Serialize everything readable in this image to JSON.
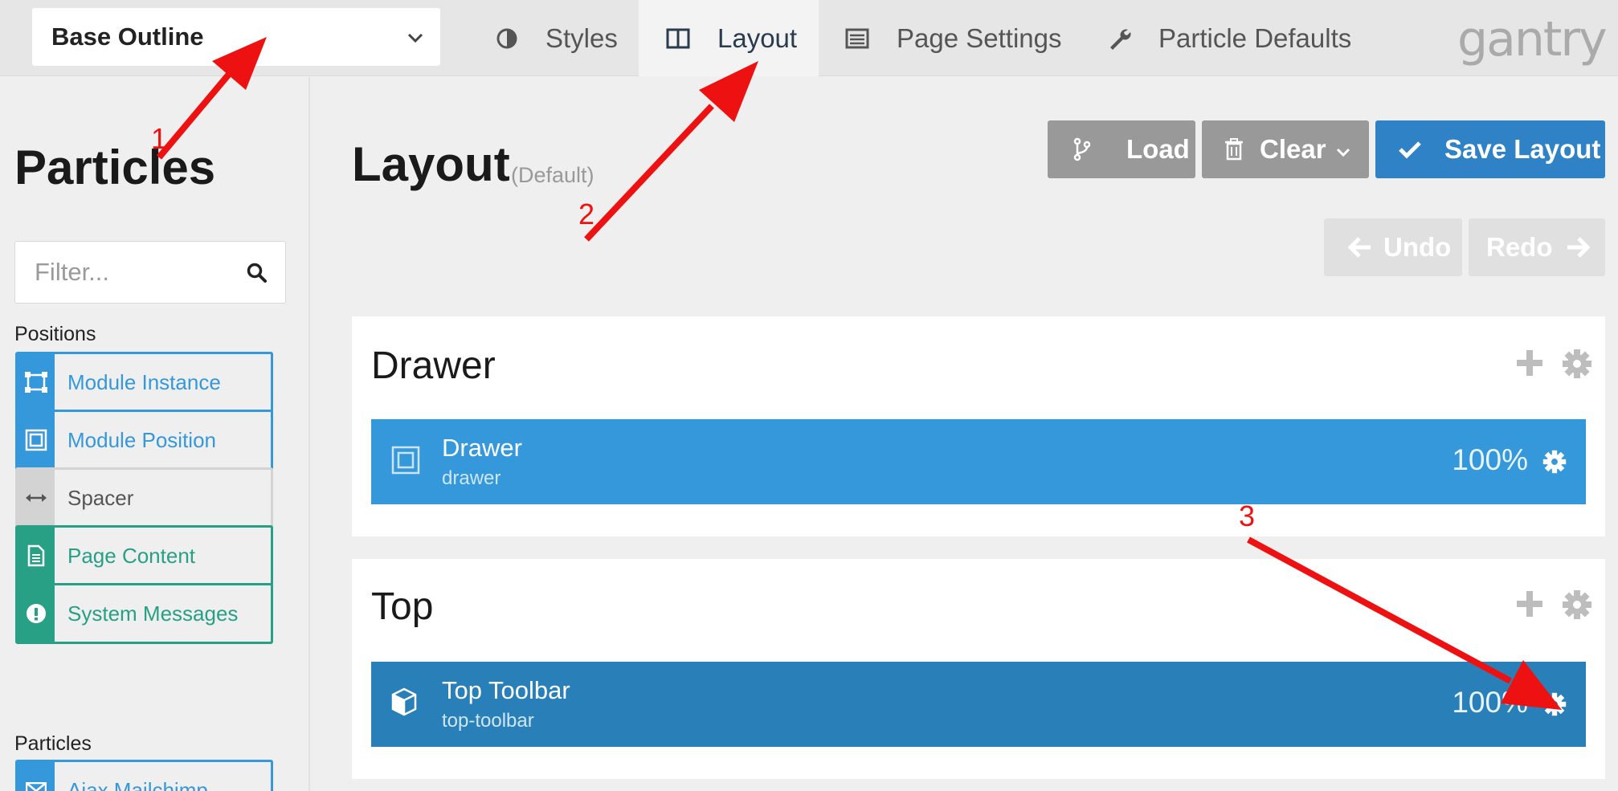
{
  "outline_selector": {
    "value": "Base Outline"
  },
  "tabs": [
    {
      "label": "Styles",
      "icon": "contrast-icon"
    },
    {
      "label": "Layout",
      "icon": "columns-icon",
      "active": true
    },
    {
      "label": "Page Settings",
      "icon": "list-alt-icon"
    },
    {
      "label": "Particle Defaults",
      "icon": "wrench-icon"
    }
  ],
  "brand": {
    "logo_text": "gantry"
  },
  "sidebar": {
    "title": "Particles",
    "filter_placeholder": "Filter...",
    "positions_label": "Positions",
    "positions": [
      {
        "label": "Module Instance",
        "icon": "module-instance-icon",
        "color": "blue"
      },
      {
        "label": "Module Position",
        "icon": "module-position-icon",
        "color": "blue"
      },
      {
        "label": "Spacer",
        "icon": "arrows-h-icon",
        "color": "grey"
      },
      {
        "label": "Page Content",
        "icon": "file-text-icon",
        "color": "green"
      },
      {
        "label": "System Messages",
        "icon": "exclamation-circle-icon",
        "color": "green"
      }
    ],
    "particles_label": "Particles",
    "particles": [
      {
        "label": "Ajax Mailchimp",
        "icon": "envelope-icon",
        "color": "blue"
      }
    ]
  },
  "main": {
    "title": "Layout",
    "subtitle": "(Default)",
    "buttons": {
      "load": "Load",
      "clear": "Clear",
      "save": "Save Layout",
      "undo": "Undo",
      "redo": "Redo"
    },
    "sections": [
      {
        "title": "Drawer",
        "block": {
          "name": "Drawer",
          "id": "drawer",
          "width": "100%"
        }
      },
      {
        "title": "Top",
        "block": {
          "name": "Top Toolbar",
          "id": "top-toolbar",
          "width": "100%"
        }
      }
    ]
  },
  "annotations": {
    "labels": [
      "1",
      "2",
      "3"
    ],
    "color": "#ee1111"
  },
  "colors": {
    "primary": "#3498db",
    "primary_dark": "#2980b9",
    "save": "#2f82c6",
    "green": "#27a085"
  }
}
